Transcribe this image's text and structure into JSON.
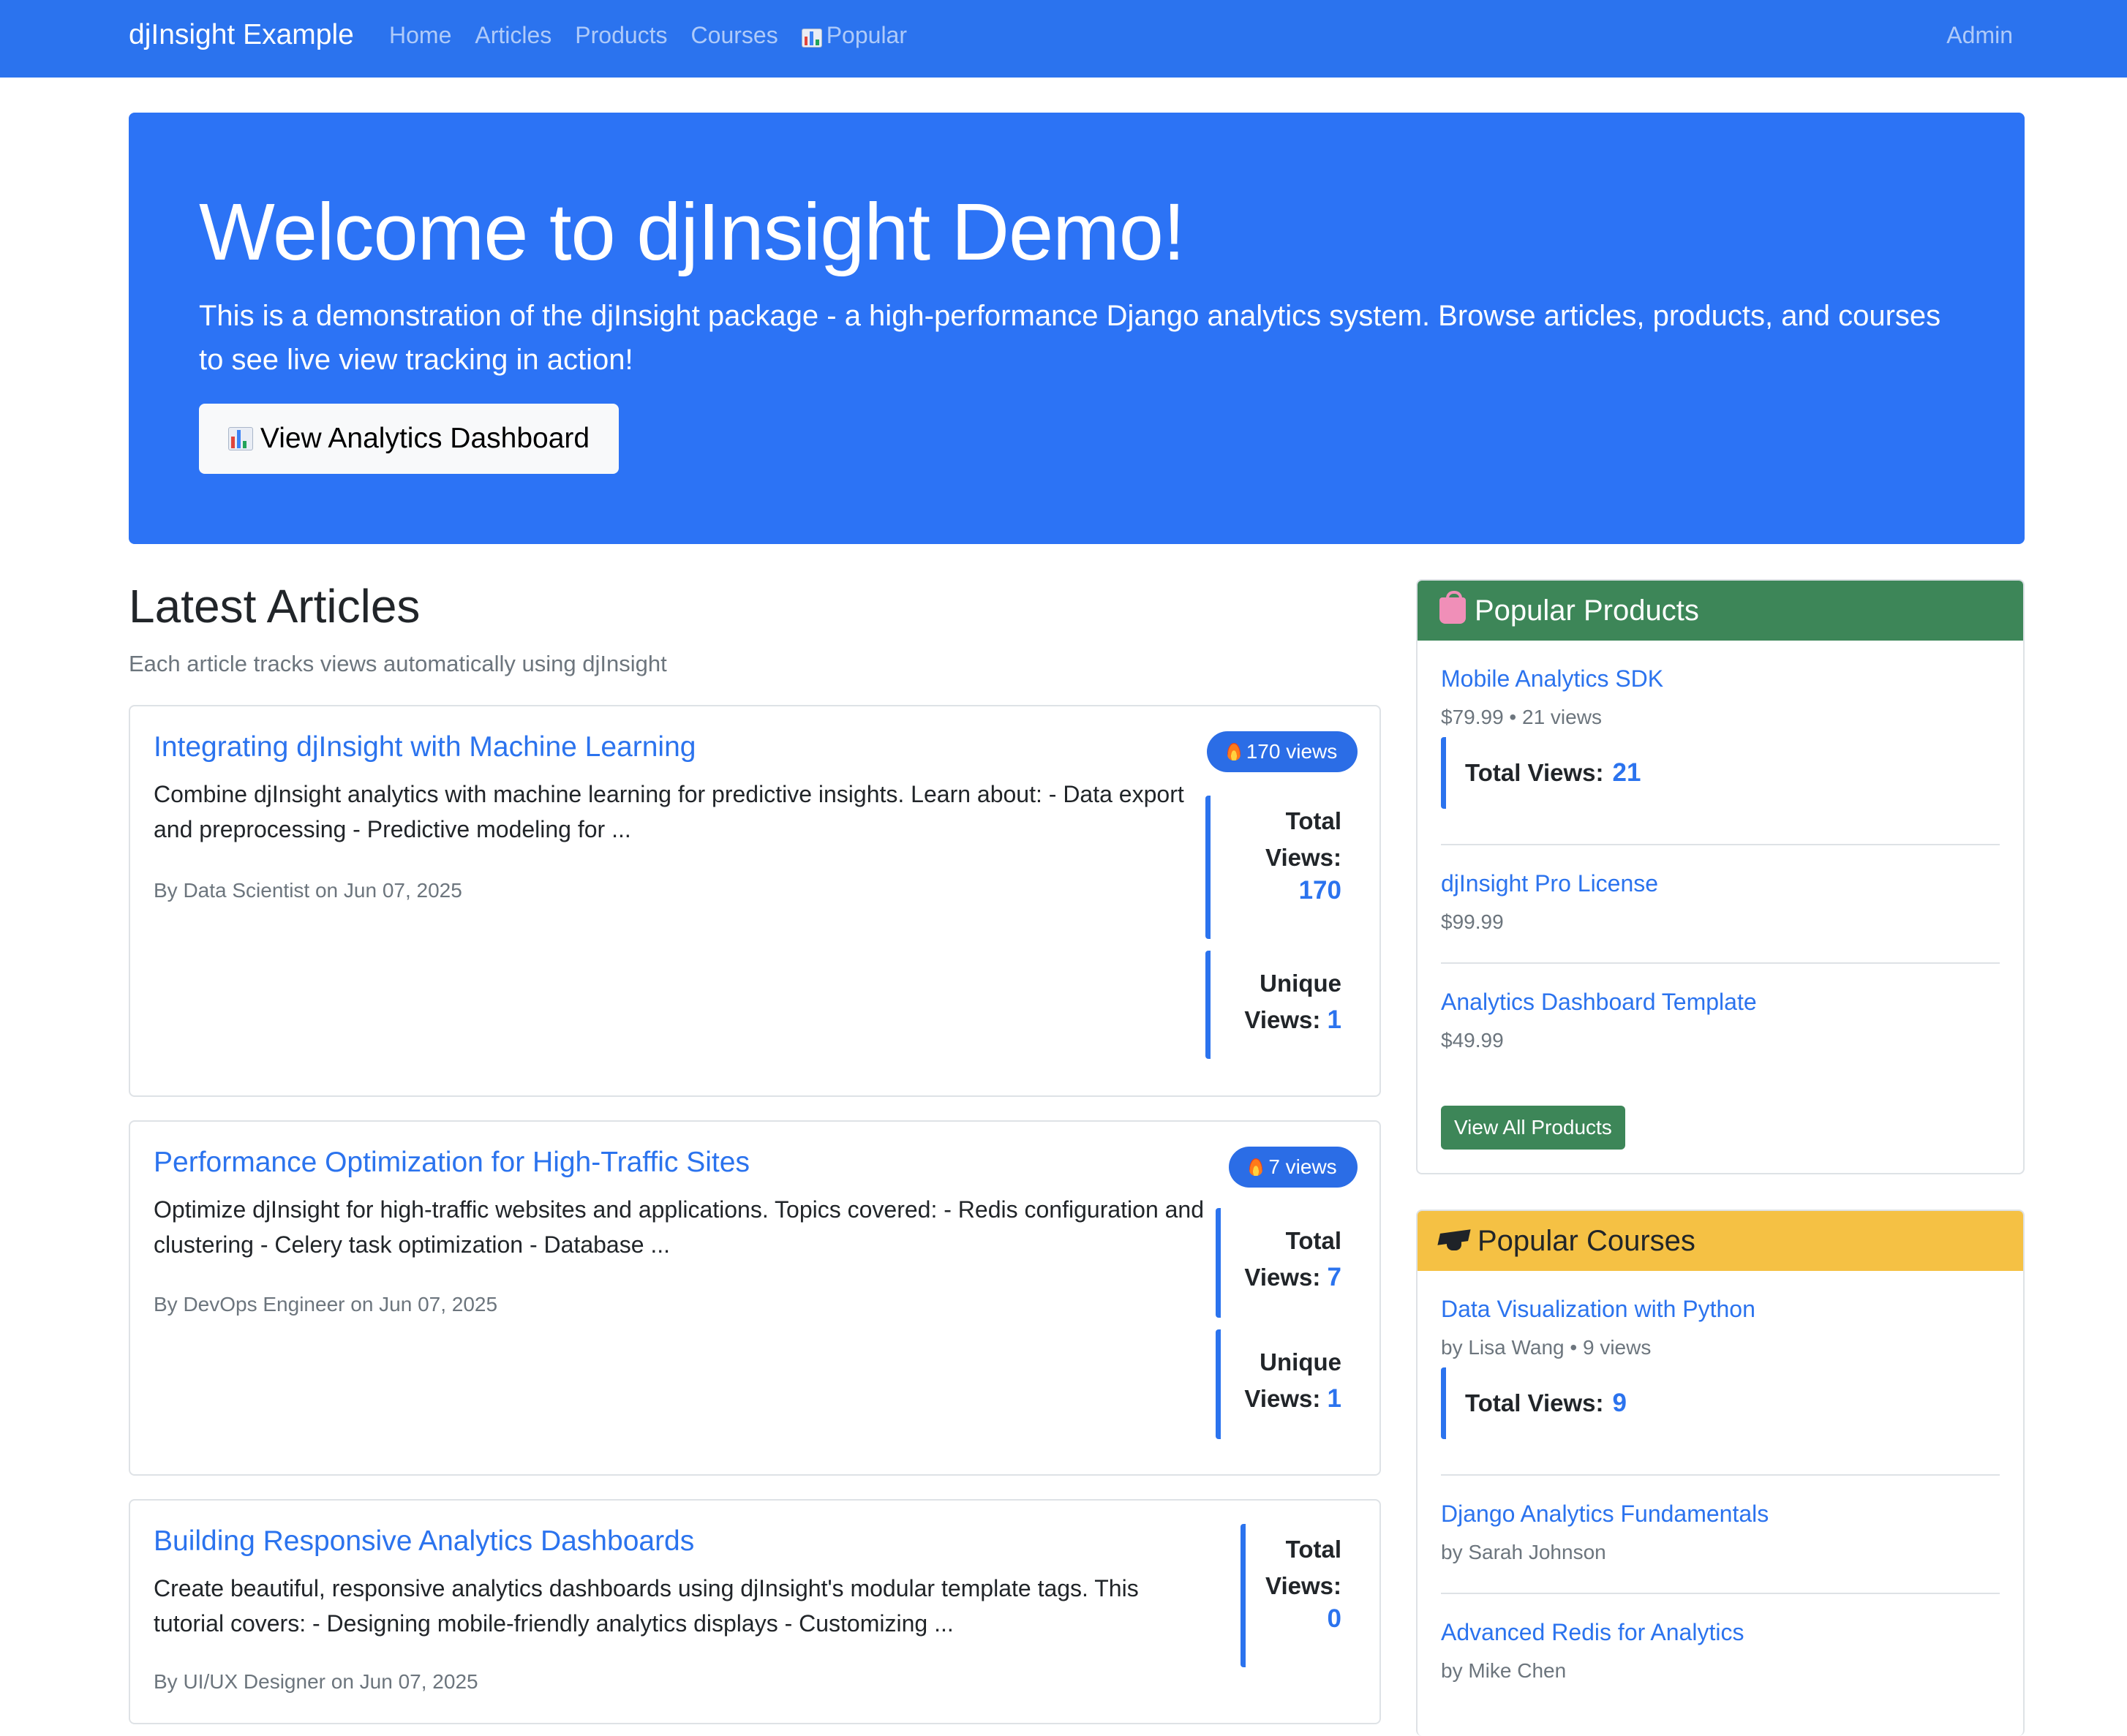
{
  "nav": {
    "brand": "djInsight Example",
    "links": [
      "Home",
      "Articles",
      "Products",
      "Courses",
      "Popular"
    ],
    "admin": "Admin"
  },
  "hero": {
    "title": "Welcome to djInsight Demo!",
    "text": "This is a demonstration of the djInsight package - a high-performance Django analytics system. Browse articles, products, and courses to see live view tracking in action!",
    "button": "View Analytics Dashboard"
  },
  "articles": {
    "title": "Latest Articles",
    "subtitle": "Each article tracks views automatically using djInsight",
    "items": [
      {
        "title": "Integrating djInsight with Machine Learning",
        "text": "Combine djInsight analytics with machine learning for predictive insights. Learn about: - Data export and preprocessing - Predictive modeling for ...",
        "meta": "By Data Scientist on Jun 07, 2025",
        "badge": "170 views",
        "total_label_1": "Total",
        "total_label_2": "Views:",
        "total_value": "170",
        "unique_label_1": "Unique",
        "unique_label_2": "Views:",
        "unique_value": "1"
      },
      {
        "title": "Performance Optimization for High-Traffic Sites",
        "text": "Optimize djInsight for high-traffic websites and applications. Topics covered: - Redis configuration and clustering - Celery task optimization - Database ...",
        "meta": "By DevOps Engineer on Jun 07, 2025",
        "badge": "7 views",
        "total_label_1": "Total",
        "total_label_2": "Views:",
        "total_value": "7",
        "unique_label_1": "Unique",
        "unique_label_2": "Views:",
        "unique_value": "1"
      },
      {
        "title": "Building Responsive Analytics Dashboards",
        "text": "Create beautiful, responsive analytics dashboards using djInsight's modular template tags. This tutorial covers: - Designing mobile-friendly analytics displays - Customizing ...",
        "meta": "By UI/UX Designer on Jun 07, 2025",
        "total_label_1": "Total",
        "total_label_2": "Views:",
        "total_value": "0"
      }
    ]
  },
  "products": {
    "title": "Popular Products",
    "items": [
      {
        "title": "Mobile Analytics SDK",
        "meta": "$79.99 • 21 views",
        "stat_label": "Total Views:",
        "stat_value": "21"
      },
      {
        "title": "djInsight Pro License",
        "meta": "$99.99"
      },
      {
        "title": "Analytics Dashboard Template",
        "meta": "$49.99"
      }
    ],
    "button": "View All Products"
  },
  "courses": {
    "title": "Popular Courses",
    "items": [
      {
        "title": "Data Visualization with Python",
        "meta": "by Lisa Wang • 9 views",
        "stat_label": "Total Views:",
        "stat_value": "9"
      },
      {
        "title": "Django Analytics Fundamentals",
        "meta": "by Sarah Johnson"
      },
      {
        "title": "Advanced Redis for Analytics",
        "meta": "by Mike Chen"
      }
    ]
  },
  "colors": {
    "primary": "#2b73ee",
    "success": "#3d8658",
    "warning": "#f5c144",
    "muted": "#6c757d"
  },
  "icons": {
    "popular": "bar-chart-icon",
    "dashboard_button": "bar-chart-icon",
    "badge": "fire-icon",
    "products": "shopping-bag-icon",
    "courses": "graduation-cap-icon"
  }
}
